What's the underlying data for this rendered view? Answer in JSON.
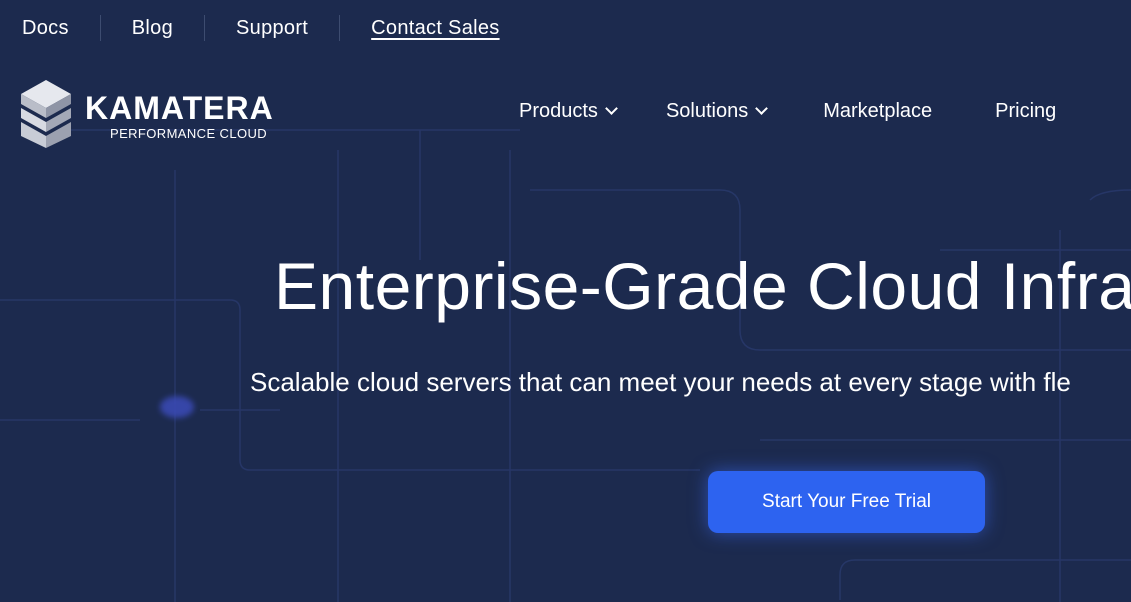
{
  "topbar": {
    "links": [
      {
        "label": "Docs"
      },
      {
        "label": "Blog"
      },
      {
        "label": "Support"
      },
      {
        "label": "Contact Sales"
      }
    ]
  },
  "logo": {
    "name": "KAMATERA",
    "tagline": "PERFORMANCE CLOUD",
    "icon": "stacked-cube-logo-icon"
  },
  "nav": {
    "items": [
      {
        "label": "Products",
        "has_dropdown": true
      },
      {
        "label": "Solutions",
        "has_dropdown": true
      },
      {
        "label": "Marketplace",
        "has_dropdown": false
      },
      {
        "label": "Pricing",
        "has_dropdown": false
      }
    ]
  },
  "hero": {
    "title": "Enterprise-Grade Cloud Infra",
    "subtitle": "Scalable cloud servers that can meet your needs at every stage with fle",
    "cta_label": "Start Your Free Trial"
  },
  "colors": {
    "background": "#1c2a4e",
    "cta": "#2d63f0",
    "text": "#ffffff"
  }
}
